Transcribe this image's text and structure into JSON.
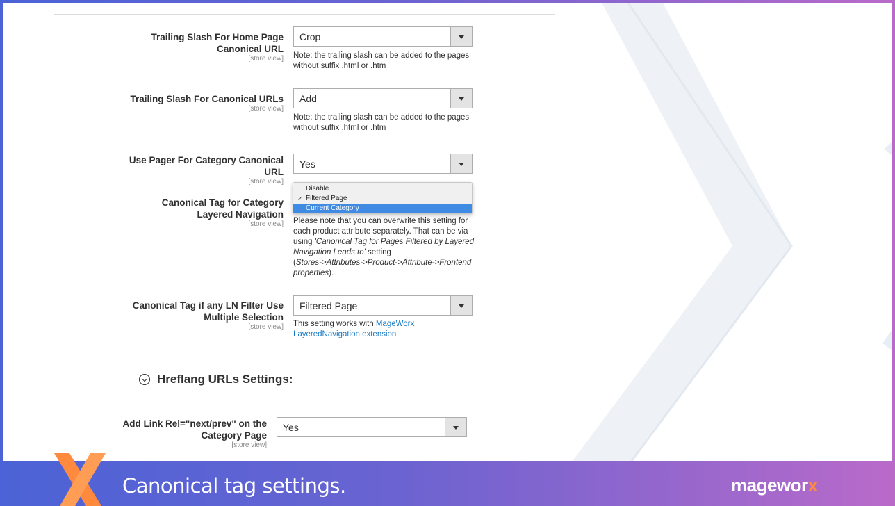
{
  "settings": [
    {
      "label_line1": "Trailing Slash For Home Page",
      "label_line2": "Canonical URL",
      "scope": "[store view]",
      "value": "Crop",
      "note_line1": "Note: the trailing slash can be added to the pages",
      "note_line2": "without suffix .html or .htm"
    },
    {
      "label_line1": "Trailing Slash For Canonical URLs",
      "scope": "[store view]",
      "value": "Add",
      "note_line1": "Note: the trailing slash can be added to the pages",
      "note_line2": "without suffix .html or .htm"
    },
    {
      "label_line1": "Use Pager For Category Canonical",
      "label_line2": "URL",
      "scope": "[store view]",
      "value": "Yes"
    },
    {
      "label_line1": "Canonical Tag for Category",
      "label_line2": "Layered Navigation",
      "scope": "[store view]",
      "dropdown_options": [
        "Disable",
        "Filtered Page",
        "Current Category"
      ],
      "checked_option": "Filtered Page",
      "highlighted_option": "Current Category",
      "note": {
        "l1": "Please note that you can overwrite this setting for",
        "l2": "each product attribute separately. That can be via",
        "l3_pre": "using ",
        "l3_em": "'Canonical Tag for Pages Filtered by Layered",
        "l4_em": "Navigation Leads to'",
        "l4_post": " setting",
        "l5_pre": "(",
        "l5_em": "Stores->Attributes->Product->Attribute->Frontend",
        "l6_em": "properties",
        "l6_post": ")."
      }
    },
    {
      "label_line1": "Canonical Tag if any LN Filter Use",
      "label_line2": "Multiple Selection",
      "scope": "[store view]",
      "value": "Filtered Page",
      "note_pre": "This setting works with ",
      "note_link1": "MageWorx",
      "note_link2": "LayeredNavigation extension"
    }
  ],
  "hreflang": {
    "section_title": "Hreflang URLs Settings:",
    "label_line1": "Add Link Rel=\"next/prev\" on the",
    "label_line2": "Category Page",
    "scope": "[store view]",
    "value": "Yes"
  },
  "footer": {
    "caption": "Canonical tag settings.",
    "logo_main": "magewor",
    "logo_x": "x"
  },
  "colors": {
    "link": "#1979c3",
    "dropdown_highlight": "#3f8be4",
    "brand_orange": "#ff8a3d",
    "frame_left": "#4b63d6",
    "frame_right": "#b96ac9"
  }
}
